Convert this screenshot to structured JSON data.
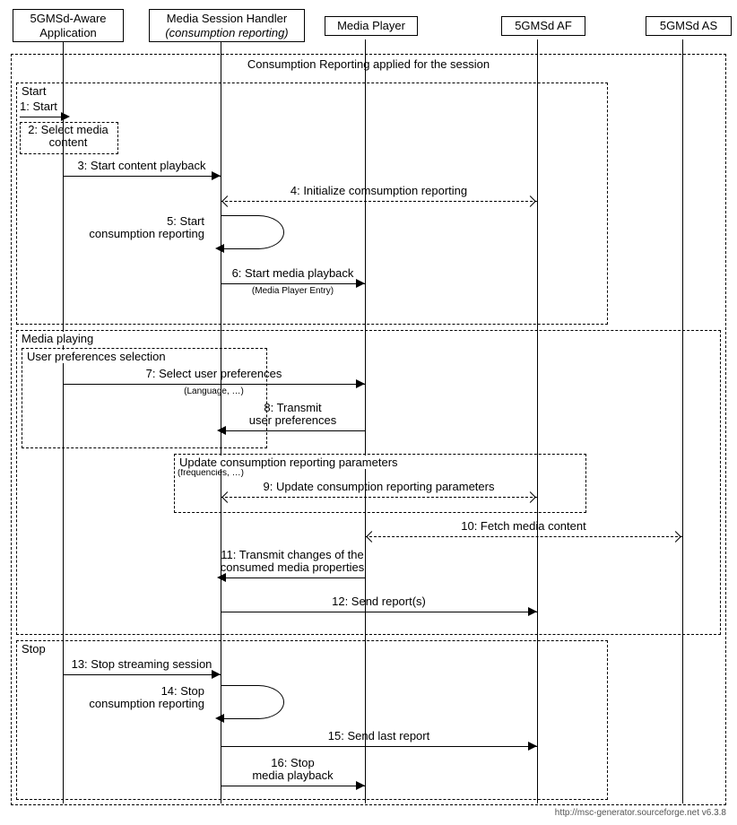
{
  "participants": {
    "app": {
      "line1": "5GMSd-Aware",
      "line2": "Application"
    },
    "msh": {
      "line1": "Media Session Handler",
      "line2": "(consumption reporting)"
    },
    "mp": {
      "line1": "Media Player"
    },
    "af": {
      "line1": "5GMSd AF"
    },
    "as": {
      "line1": "5GMSd AS"
    }
  },
  "boxes": {
    "overall": "Consumption Reporting applied for the session",
    "start": "Start",
    "sel": "2: Select media\ncontent",
    "playing": "Media playing",
    "userpref": "User preferences selection",
    "update": "Update consumption reporting parameters",
    "updateSub": "(frequencies, …)",
    "stop": "Stop"
  },
  "messages": {
    "m1": "1: Start",
    "m3": "3: Start content playback",
    "m4": "4: Initialize comsumption reporting",
    "m5": "5: Start\nconsumption reporting",
    "m6": "6: Start media playback",
    "m6sub": "(Media Player Entry)",
    "m7": "7: Select user preferences",
    "m7sub": "(Language, …)",
    "m8": "8: Transmit\nuser preferences",
    "m9": "9: Update consumption reporting parameters",
    "m10": "10: Fetch media content",
    "m11": "11: Transmit changes of the\nconsumed media properties",
    "m12": "12: Send report(s)",
    "m13": "13: Stop streaming session",
    "m14": "14: Stop\nconsumption reporting",
    "m15": "15: Send last report",
    "m16": "16: Stop\nmedia playback"
  },
  "footer": "http://msc-generator.sourceforge.net v6.3.8"
}
